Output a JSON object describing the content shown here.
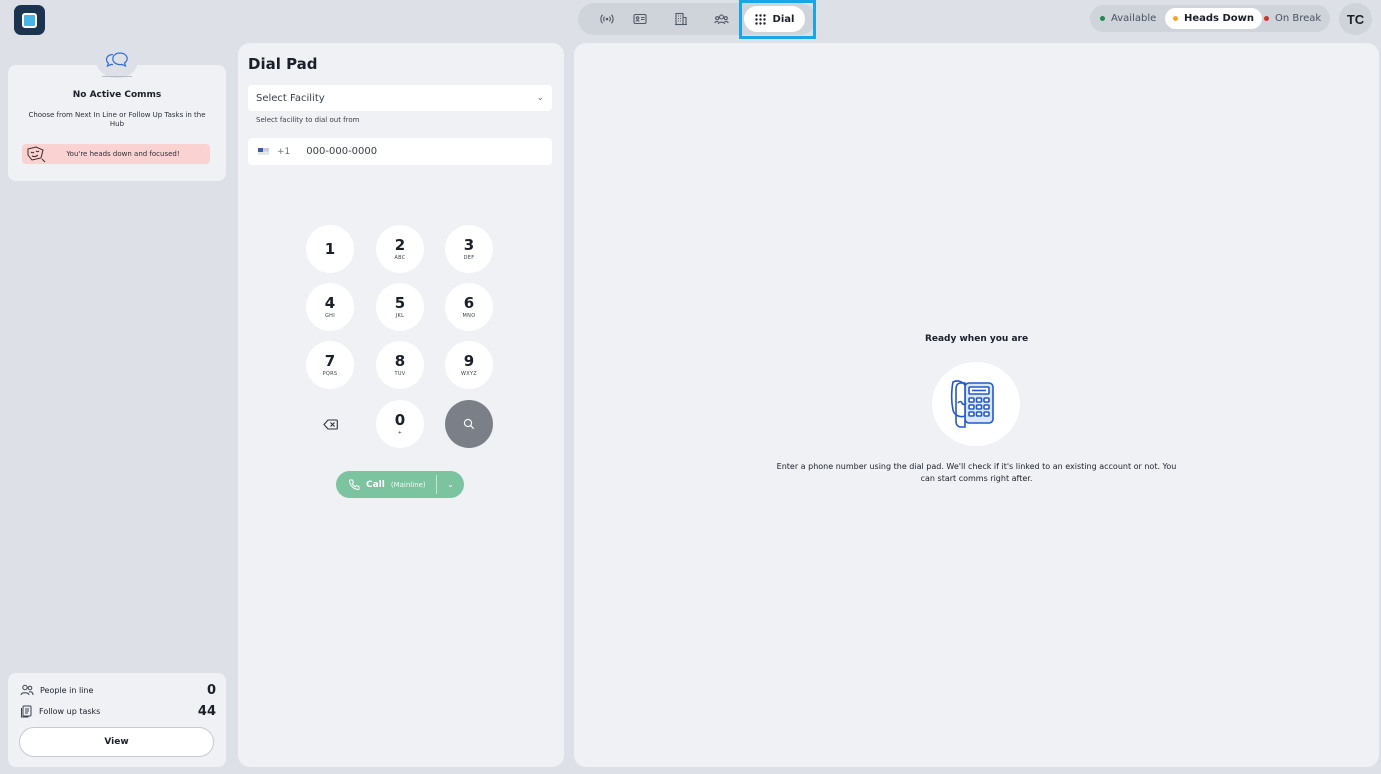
{
  "nav": {
    "icons": [
      "broadcast-icon",
      "contact-card-icon",
      "building-icon",
      "group-icon"
    ],
    "dial_label": "Dial"
  },
  "status": {
    "options": [
      {
        "label": "Available",
        "color": "#1f8a4c"
      },
      {
        "label": "Heads Down",
        "color": "#f5a623",
        "active": true
      },
      {
        "label": "On Break",
        "color": "#d0312d"
      }
    ]
  },
  "user": {
    "initials": "TC"
  },
  "comms": {
    "title": "No Active Comms",
    "subtitle": "Choose from Next In Line or Follow Up Tasks in the Hub",
    "banner": "You're heads down and focused!"
  },
  "queue": {
    "people_label": "People in line",
    "people_count": "0",
    "tasks_label": "Follow up tasks",
    "tasks_count": "44",
    "view_label": "View"
  },
  "dialpad": {
    "title": "Dial Pad",
    "facility_placeholder": "Select Facility",
    "facility_help": "Select facility to dial out from",
    "country_code": "+1",
    "phone_placeholder": "000-000-0000",
    "keys": [
      {
        "digit": "1",
        "letters": ""
      },
      {
        "digit": "2",
        "letters": "ABC"
      },
      {
        "digit": "3",
        "letters": "DEF"
      },
      {
        "digit": "4",
        "letters": "GHI"
      },
      {
        "digit": "5",
        "letters": "JKL"
      },
      {
        "digit": "6",
        "letters": "MNO"
      },
      {
        "digit": "7",
        "letters": "PQRS"
      },
      {
        "digit": "8",
        "letters": "TUV"
      },
      {
        "digit": "9",
        "letters": "WXYZ"
      },
      {
        "digit": "0",
        "letters": "+"
      }
    ],
    "call_label": "Call",
    "call_line": "(Mainline)"
  },
  "main": {
    "ready_title": "Ready when you are",
    "ready_desc": "Enter a phone number using the dial pad. We'll check if it's linked to an existing account or not. You can start comms right after."
  }
}
